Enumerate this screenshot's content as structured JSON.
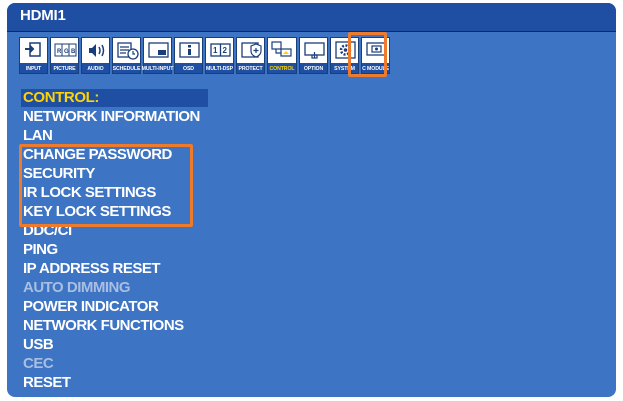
{
  "window": {
    "title": "HDMI1"
  },
  "tabs": [
    {
      "label": "INPUT",
      "icon": "input-icon"
    },
    {
      "label": "PICTURE",
      "icon": "picture-icon"
    },
    {
      "label": "AUDIO",
      "icon": "audio-icon"
    },
    {
      "label": "SCHEDULE",
      "icon": "schedule-icon"
    },
    {
      "label": "MULTI-INPUT",
      "icon": "multi-input-icon"
    },
    {
      "label": "OSD",
      "icon": "osd-icon"
    },
    {
      "label": "MULTI-DSP",
      "icon": "multi-dsp-icon"
    },
    {
      "label": "PROTECT",
      "icon": "protect-icon"
    },
    {
      "label": "CONTROL",
      "icon": "control-icon",
      "active": true
    },
    {
      "label": "OPTION",
      "icon": "option-icon"
    },
    {
      "label": "SYSTEM",
      "icon": "system-icon"
    },
    {
      "label": "C MODULE",
      "icon": "c-module-icon"
    }
  ],
  "menu": {
    "header": "CONTROL:",
    "items": [
      {
        "label": "NETWORK INFORMATION",
        "enabled": true
      },
      {
        "label": "LAN",
        "enabled": true
      },
      {
        "label": "CHANGE PASSWORD",
        "enabled": true
      },
      {
        "label": "SECURITY",
        "enabled": true
      },
      {
        "label": "IR LOCK SETTINGS",
        "enabled": true
      },
      {
        "label": "KEY LOCK SETTINGS",
        "enabled": true
      },
      {
        "label": "DDC/CI",
        "enabled": true
      },
      {
        "label": "PING",
        "enabled": true
      },
      {
        "label": "IP ADDRESS RESET",
        "enabled": true
      },
      {
        "label": "AUTO DIMMING",
        "enabled": false
      },
      {
        "label": "POWER INDICATOR",
        "enabled": true
      },
      {
        "label": "NETWORK FUNCTIONS",
        "enabled": true
      },
      {
        "label": "USB",
        "enabled": true
      },
      {
        "label": "CEC",
        "enabled": false
      },
      {
        "label": "RESET",
        "enabled": true
      }
    ]
  },
  "colors": {
    "background": "#3d74c4",
    "title_bar": "#1f4fa3",
    "menu_header": "#ffd400",
    "disabled_text": "#a9bfe2",
    "callout": "#ee7a2c"
  }
}
